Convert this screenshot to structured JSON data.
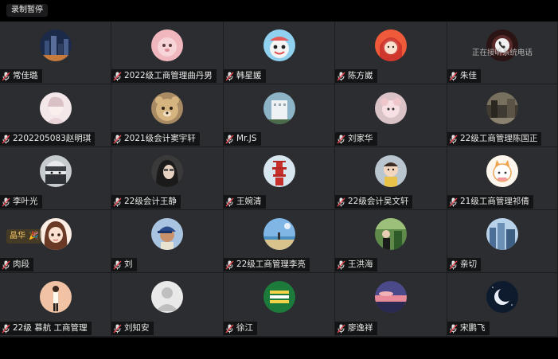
{
  "recording_badge": "录制暂停",
  "call_status": "正在接听系统电话",
  "emoji_badge": "晶华",
  "colors": {
    "tile_bg": "#2c2d30",
    "name_bg": "rgba(0,0,0,0.55)",
    "mic_red": "#e0404a"
  },
  "participants": [
    {
      "name": "常佳璐",
      "avatar": "night-city-avatar"
    },
    {
      "name": "2022级工商管理曲丹男",
      "avatar": "pink-plush-avatar"
    },
    {
      "name": "韩星媛",
      "avatar": "cartoon-blue-avatar"
    },
    {
      "name": "陈方崴",
      "avatar": "red-hood-girl-avatar"
    },
    {
      "name": "朱佳",
      "avatar": "phone-call-avatar"
    },
    {
      "name": "2202205083赵明琪",
      "avatar": "pale-portrait-avatar"
    },
    {
      "name": "2021级会计窦宇轩",
      "avatar": "bear-face-avatar"
    },
    {
      "name": "Mr.JS",
      "avatar": "white-building-avatar"
    },
    {
      "name": "刘家华",
      "avatar": "pink-toy-avatar"
    },
    {
      "name": "22级工商管理陈国正",
      "avatar": "street-view-avatar"
    },
    {
      "name": "李叶光",
      "avatar": "masked-ninja-avatar"
    },
    {
      "name": "22级会计王静",
      "avatar": "dark-hair-girl-avatar"
    },
    {
      "name": "王婉清",
      "avatar": "red-pagoda-avatar"
    },
    {
      "name": "22级会计吴文轩",
      "avatar": "child-avatar"
    },
    {
      "name": "21级工商管理祁倩",
      "avatar": "cartoon-cat-avatar"
    },
    {
      "name": "肉段",
      "avatar": "anime-girl-avatar"
    },
    {
      "name": "刘",
      "avatar": "boy-cap-avatar"
    },
    {
      "name": "22级工商管理李亮",
      "avatar": "beach-sky-avatar"
    },
    {
      "name": "王洪海",
      "avatar": "green-outdoor-avatar"
    },
    {
      "name": "亲切",
      "avatar": "blue-buildings-avatar"
    },
    {
      "name": "22级 慕航 工商管理",
      "avatar": "standing-figure-avatar"
    },
    {
      "name": "刘知安",
      "avatar": "default-user-avatar"
    },
    {
      "name": "徐江",
      "avatar": "green-logo-avatar"
    },
    {
      "name": "廖逸祥",
      "avatar": "sunset-clouds-avatar"
    },
    {
      "name": "宋鹏飞",
      "avatar": "crescent-moon-avatar"
    }
  ]
}
